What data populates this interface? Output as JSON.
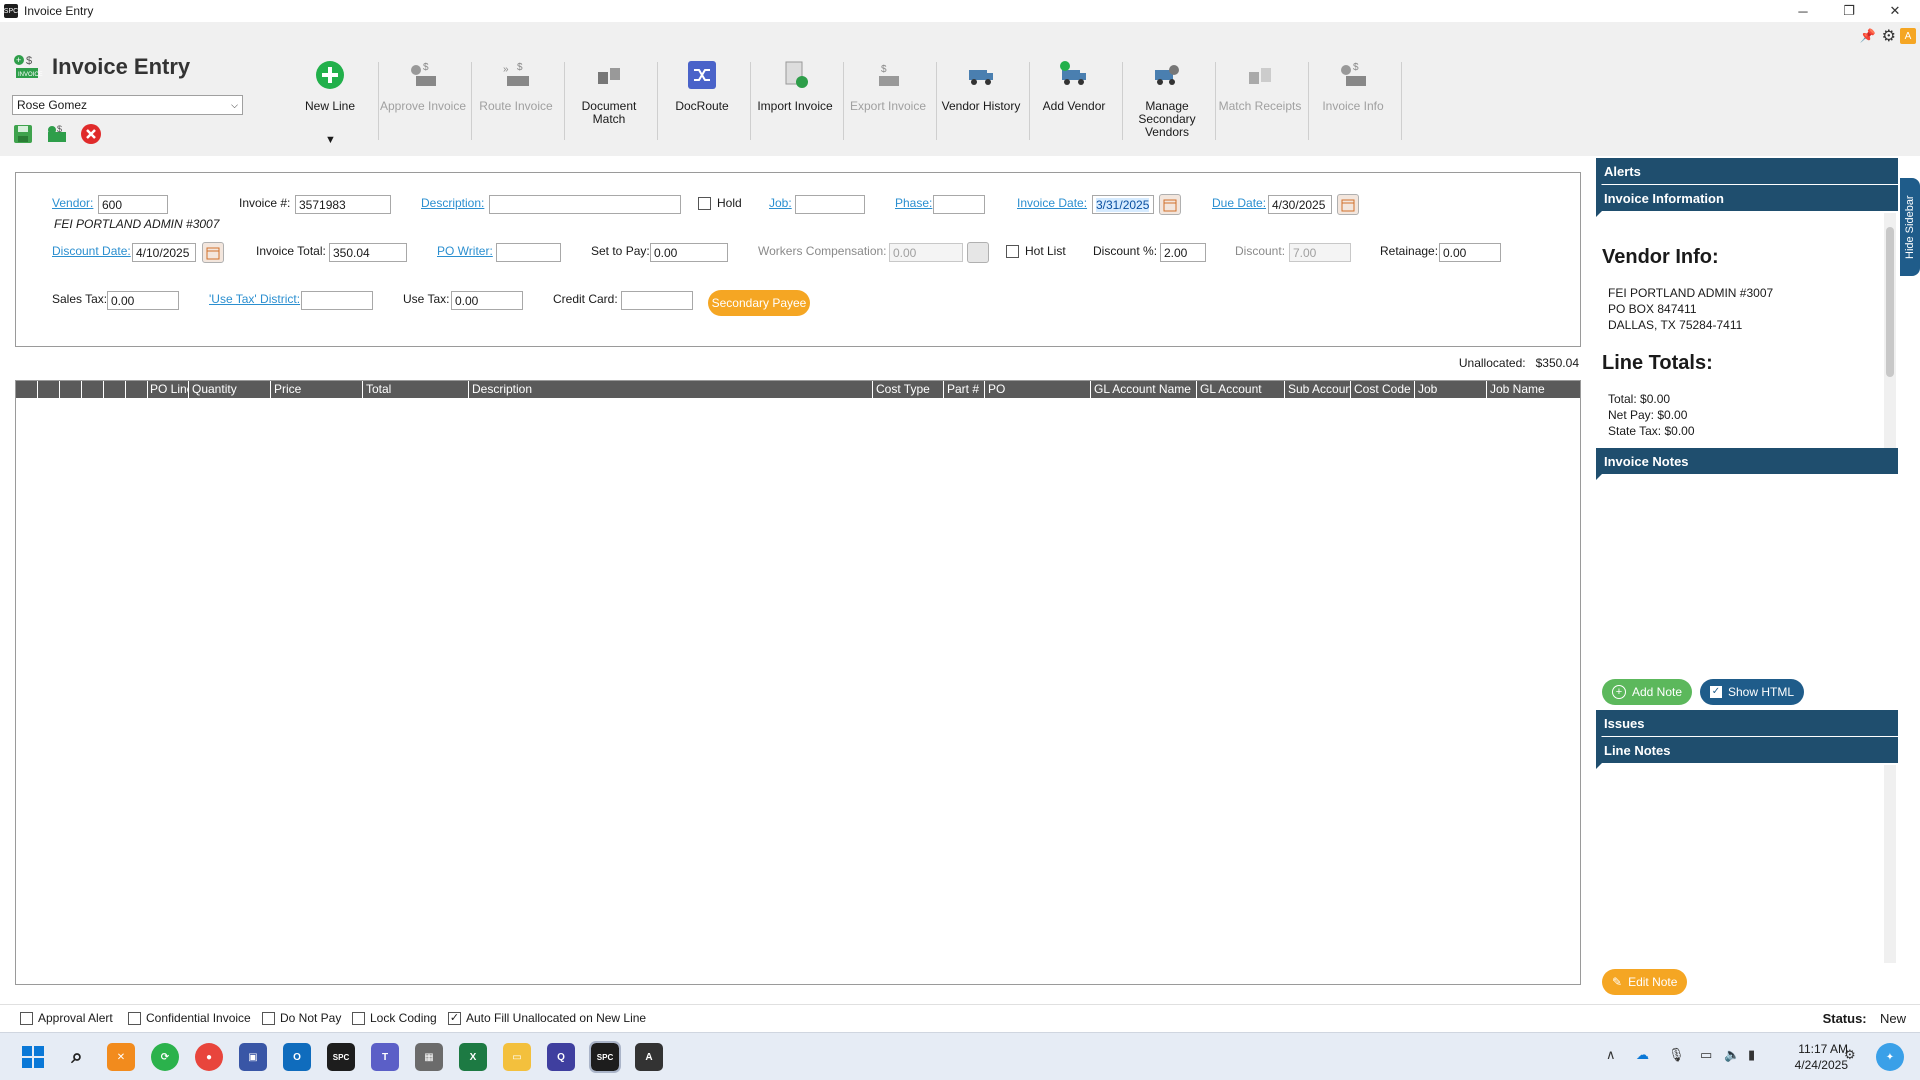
{
  "window": {
    "title": "Invoice Entry"
  },
  "app": {
    "title": "Invoice Entry",
    "user": "Rose Gomez"
  },
  "toolbar": {
    "buttons": [
      {
        "label": "New Line",
        "enabled": true,
        "icon": "add-circle-icon"
      },
      {
        "label": "Approve Invoice",
        "enabled": false,
        "icon": "approve-invoice-icon"
      },
      {
        "label": "Route Invoice",
        "enabled": false,
        "icon": "route-invoice-icon"
      },
      {
        "label": "Document Match",
        "enabled": true,
        "icon": "document-match-icon"
      },
      {
        "label": "DocRoute",
        "enabled": true,
        "icon": "shuffle-icon"
      },
      {
        "label": "Import Invoice",
        "enabled": true,
        "icon": "import-invoice-icon"
      },
      {
        "label": "Export Invoice",
        "enabled": false,
        "icon": "export-invoice-icon"
      },
      {
        "label": "Vendor History",
        "enabled": true,
        "icon": "vendor-history-icon"
      },
      {
        "label": "Add Vendor",
        "enabled": true,
        "icon": "add-vendor-icon"
      },
      {
        "label": "Manage Secondary Vendors",
        "enabled": true,
        "icon": "manage-vendors-icon"
      },
      {
        "label": "Match Receipts",
        "enabled": false,
        "icon": "match-receipts-icon"
      },
      {
        "label": "Invoice Info",
        "enabled": false,
        "icon": "invoice-info-icon"
      }
    ],
    "dropdown_arrow": "▼"
  },
  "form": {
    "vendor_label": "Vendor:",
    "vendor_value": "600",
    "vendor_name": "FEI PORTLAND ADMIN #3007",
    "invoice_no_label": "Invoice #:",
    "invoice_no_value": "3571983",
    "description_label": "Description:",
    "description_value": "",
    "hold_label": "Hold",
    "job_label": "Job:",
    "job_value": "",
    "phase_label": "Phase:",
    "phase_value": "",
    "invoice_date_label": "Invoice Date:",
    "invoice_date_value": "3/31/2025",
    "due_date_label": "Due Date:",
    "due_date_value": "4/30/2025",
    "discount_date_label": "Discount Date:",
    "discount_date_value": "4/10/2025",
    "invoice_total_label": "Invoice Total:",
    "invoice_total_value": "350.04",
    "po_writer_label": "PO Writer:",
    "po_writer_value": "",
    "set_to_pay_label": "Set to Pay:",
    "set_to_pay_value": "0.00",
    "workers_comp_label": "Workers Compensation:",
    "workers_comp_value": "0.00",
    "hot_list_label": "Hot List",
    "discount_pct_label": "Discount %:",
    "discount_pct_value": "2.00",
    "discount_label": "Discount:",
    "discount_value": "7.00",
    "retainage_label": "Retainage:",
    "retainage_value": "0.00",
    "sales_tax_label": "Sales Tax:",
    "sales_tax_value": "0.00",
    "use_tax_district_label": "'Use Tax' District:",
    "use_tax_district_value": "",
    "use_tax_label": "Use Tax:",
    "use_tax_value": "0.00",
    "credit_card_label": "Credit Card:",
    "credit_card_value": "",
    "secondary_payee_label": "Secondary Payee"
  },
  "unallocated": {
    "label": "Unallocated:",
    "value": "$350.04"
  },
  "grid": {
    "columns": [
      "",
      "",
      "",
      "",
      "",
      "",
      "PO Line",
      "Quantity",
      "Price",
      "Total",
      "Description",
      "Cost Type",
      "Part #",
      "PO",
      "GL Account Name",
      "GL Account",
      "Sub Account",
      "Cost Code",
      "Job",
      "Job Name"
    ]
  },
  "sidebar": {
    "alerts": "Alerts",
    "invoice_information": "Invoice Information",
    "vendor_info_title": "Vendor Info:",
    "vendor_lines": [
      "FEI PORTLAND ADMIN #3007",
      "PO BOX 847411",
      "DALLAS, TX 75284-7411"
    ],
    "line_totals_title": "Line Totals:",
    "totals": [
      {
        "label": "Total:",
        "value": "$0.00"
      },
      {
        "label": "Net Pay:",
        "value": "$0.00"
      },
      {
        "label": "State Tax:",
        "value": "$0.00"
      }
    ],
    "invoice_notes": "Invoice Notes",
    "add_note": "Add Note",
    "show_html": "Show HTML",
    "issues": "Issues",
    "line_notes": "Line Notes",
    "edit_note": "Edit Note",
    "hide_sidebar": "Hide Sidebar"
  },
  "bottom": {
    "checkboxes": [
      {
        "label": "Approval Alert",
        "checked": false
      },
      {
        "label": "Confidential Invoice",
        "checked": false
      },
      {
        "label": "Do Not Pay",
        "checked": false
      },
      {
        "label": "Lock Coding",
        "checked": false
      },
      {
        "label": "Auto Fill Unallocated on New Line",
        "checked": true
      }
    ],
    "status_label": "Status:",
    "status_value": "New"
  },
  "taskbar": {
    "time": "11:17 AM",
    "date": "4/24/2025"
  },
  "colors": {
    "accent": "#1f4e6e",
    "link": "#2b8fd0",
    "orange": "#f5a623",
    "header_gray": "#5a5a5a"
  }
}
